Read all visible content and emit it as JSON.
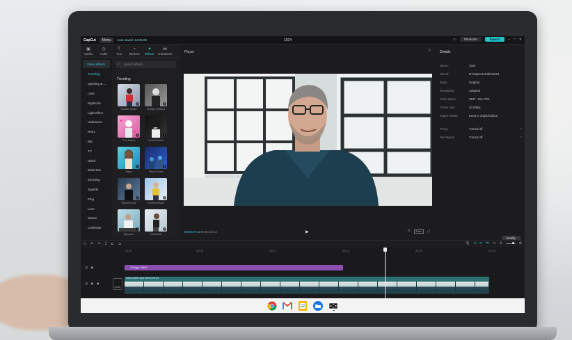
{
  "titlebar": {
    "logo": "CapCut",
    "menu": "Menu",
    "autosave": "Auto saved: 14:35:08",
    "project": "1024",
    "shortcuts": "Shortcuts",
    "export": "Export"
  },
  "tabs": [
    {
      "label": "Media",
      "icon": "media-icon"
    },
    {
      "label": "Audio",
      "icon": "audio-icon"
    },
    {
      "label": "Text",
      "icon": "text-icon"
    },
    {
      "label": "Stickers",
      "icon": "stickers-icon"
    },
    {
      "label": "Effects",
      "icon": "effects-icon",
      "active": true
    },
    {
      "label": "Transitions",
      "icon": "transitions-icon"
    }
  ],
  "categories": {
    "main": "Video effects",
    "items": [
      "Trending",
      "Opening & ...",
      "Lens",
      "Nightclub",
      "Light effect",
      "Halloween",
      "Retro",
      "Bar",
      "TV",
      "Glitch",
      "Distortion",
      "Zooming",
      "Sparkle",
      "Ping",
      "Love",
      "Nature",
      "Celebrate"
    ]
  },
  "effects": {
    "search_placeholder": "Search effects",
    "section": "Trending",
    "thumbs": [
      {
        "label": "Sparkle Shake"
      },
      {
        "label": "Vintage Shadow"
      },
      {
        "label": "Pink Hearts"
      },
      {
        "label": "Heart Brushes"
      },
      {
        "label": "Wave"
      },
      {
        "label": "Neon Crowd"
      },
      {
        "label": "Speed Drops"
      },
      {
        "label": "Camera Shake"
      },
      {
        "label": "Blackout"
      },
      {
        "label": "Flashback"
      }
    ]
  },
  "player": {
    "title": "Player",
    "current": "00:00:07:13",
    "total": "00:00:29:13",
    "ratio": "Ratio"
  },
  "details": {
    "title": "Details",
    "rows": [
      {
        "label": "Name:",
        "value": "1024"
      },
      {
        "label": "Saved:",
        "value": "D:\\CapCut Drafts\\1024"
      },
      {
        "label": "Ratio:",
        "value": "Original"
      },
      {
        "label": "Resolution:",
        "value": "Adapted"
      },
      {
        "label": "Color space:",
        "value": "SDR - Rec.709"
      },
      {
        "label": "Frame rate:",
        "value": "30.00fps"
      },
      {
        "label": "Import media:",
        "value": "Keep in original place"
      },
      {
        "label": "Proxy:",
        "value": "Turned off"
      },
      {
        "label": "Text layers:",
        "value": "Turned off"
      }
    ],
    "modify": "Modify"
  },
  "timeline": {
    "ticks": [
      "00:00",
      "|00:05",
      "|00:10",
      "|00:15",
      "|00:20",
      "|00:25"
    ],
    "effect_clip": "Vintage effect",
    "video_clip": "video1024.mp4  00:00:29:13",
    "cover": "Cover"
  },
  "colors": {
    "accent": "#2fd0d6",
    "effect_track": "#8a4fb0",
    "video_track": "#2a6f72"
  },
  "taskbar": [
    "chrome-icon",
    "gmail-icon",
    "docs-icon",
    "files-icon",
    "capcut-icon"
  ]
}
